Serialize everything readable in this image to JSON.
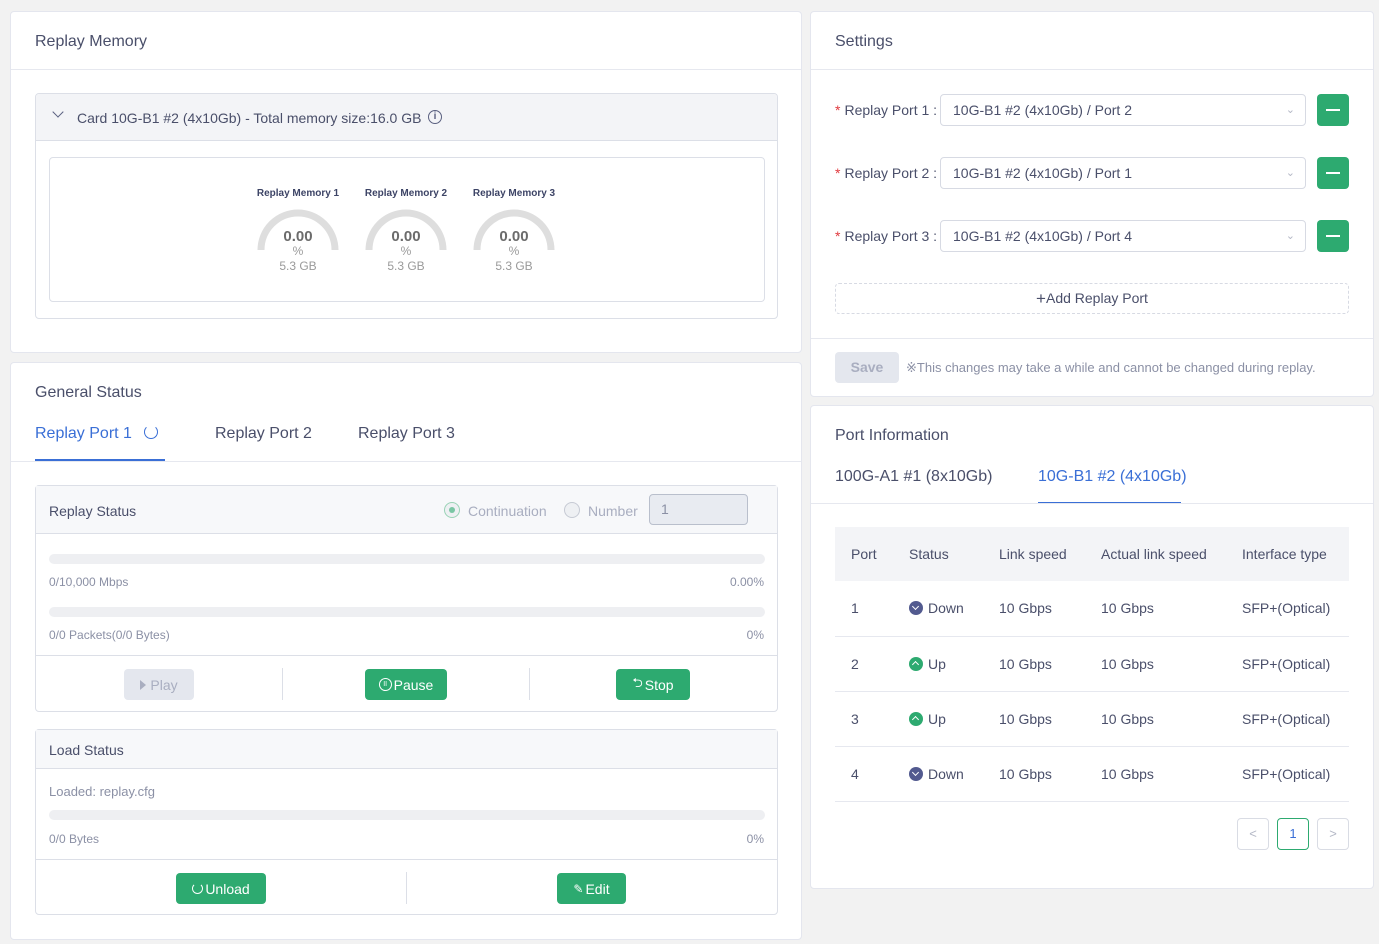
{
  "replay_memory": {
    "title": "Replay Memory",
    "card_label": "Card 10G-B1 #2 (4x10Gb) - Total memory size:16.0 GB",
    "gauges": [
      {
        "title": "Replay Memory 1",
        "value": "0.00",
        "unit": "%",
        "size": "5.3 GB"
      },
      {
        "title": "Replay Memory 2",
        "value": "0.00",
        "unit": "%",
        "size": "5.3 GB"
      },
      {
        "title": "Replay Memory 3",
        "value": "0.00",
        "unit": "%",
        "size": "5.3 GB"
      }
    ]
  },
  "general_status": {
    "title": "General Status",
    "tabs": [
      {
        "label": "Replay Port 1"
      },
      {
        "label": "Replay Port 2"
      },
      {
        "label": "Replay Port 3"
      }
    ],
    "replay_status": {
      "title": "Replay Status",
      "radio_continuation": "Continuation",
      "radio_number": "Number",
      "number_value": "1",
      "rate_text": "0/10,000 Mbps",
      "rate_pct": "0.00%",
      "packets_text": "0/0 Packets(0/0 Bytes)",
      "packets_pct": "0%",
      "play_label": "Play",
      "pause_label": "Pause",
      "stop_label": "Stop"
    },
    "load_status": {
      "title": "Load Status",
      "loaded_text": "Loaded: replay.cfg",
      "bytes_text": "0/0 Bytes",
      "bytes_pct": "0%",
      "unload_label": "Unload",
      "edit_label": "Edit"
    }
  },
  "settings": {
    "title": "Settings",
    "ports": [
      {
        "label": "Replay Port 1 :",
        "value": "10G-B1 #2 (4x10Gb) / Port 2"
      },
      {
        "label": "Replay Port 2 :",
        "value": "10G-B1 #2 (4x10Gb) / Port 1"
      },
      {
        "label": "Replay Port 3 :",
        "value": "10G-B1 #2 (4x10Gb) / Port 4"
      }
    ],
    "add_label": "Add Replay Port",
    "save_label": "Save",
    "note": "※This changes may take a while and cannot be changed during replay."
  },
  "port_info": {
    "title": "Port Information",
    "tabs": [
      {
        "label": "100G-A1 #1 (8x10Gb)"
      },
      {
        "label": "10G-B1 #2 (4x10Gb)"
      }
    ],
    "columns": [
      "Port",
      "Status",
      "Link speed",
      "Actual link speed",
      "Interface type"
    ],
    "rows": [
      {
        "port": "1",
        "status": "Down",
        "link": "10 Gbps",
        "actual": "10 Gbps",
        "iface": "SFP+(Optical)"
      },
      {
        "port": "2",
        "status": "Up",
        "link": "10 Gbps",
        "actual": "10 Gbps",
        "iface": "SFP+(Optical)"
      },
      {
        "port": "3",
        "status": "Up",
        "link": "10 Gbps",
        "actual": "10 Gbps",
        "iface": "SFP+(Optical)"
      },
      {
        "port": "4",
        "status": "Down",
        "link": "10 Gbps",
        "actual": "10 Gbps",
        "iface": "SFP+(Optical)"
      }
    ],
    "page": "1"
  },
  "colors": {
    "accent_green": "#2daa70",
    "accent_blue": "#3a6fd6",
    "status_down": "#525a8f"
  }
}
